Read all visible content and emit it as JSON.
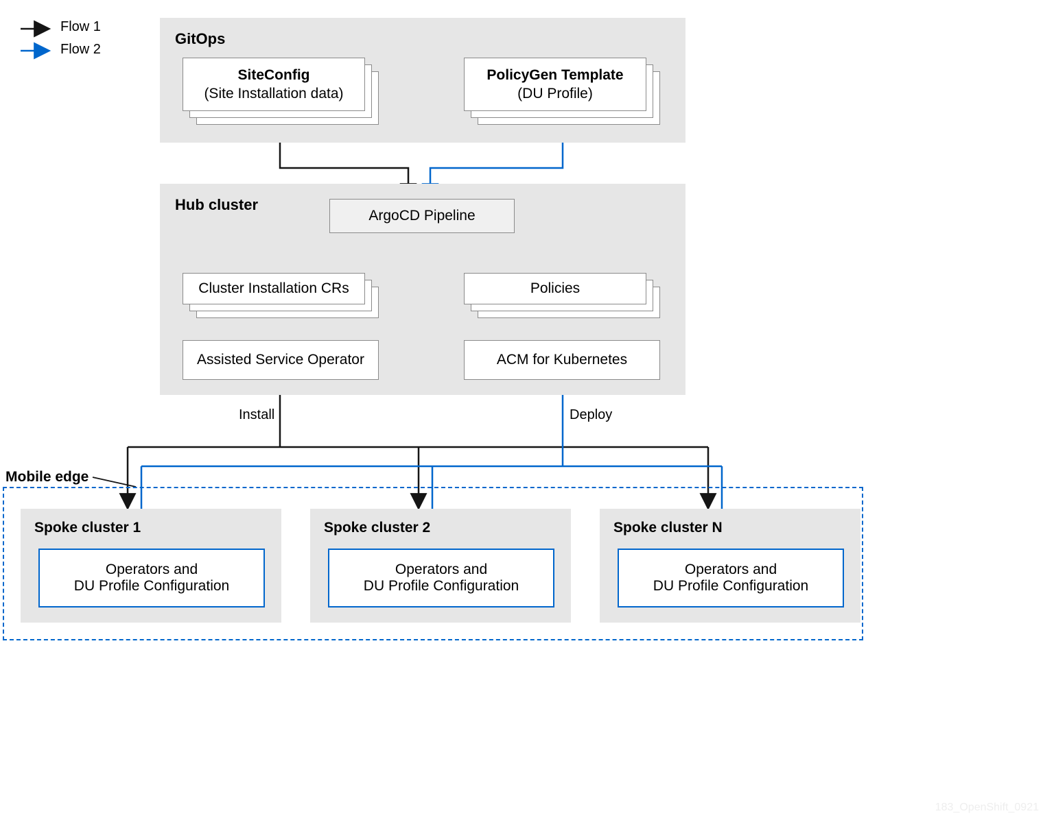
{
  "legend": {
    "flow1": "Flow 1",
    "flow2": "Flow 2"
  },
  "gitops": {
    "title": "GitOps",
    "siteconfig": {
      "title": "SiteConfig",
      "sub": "(Site Installation data)"
    },
    "policygen": {
      "title": "PolicyGen Template",
      "sub": "(DU Profile)"
    }
  },
  "hub": {
    "title": "Hub cluster",
    "argocd": "ArgoCD Pipeline",
    "clustercrs": "Cluster Installation CRs",
    "policies": "Policies",
    "assisted": "Assisted Service Operator",
    "acm": "ACM for Kubernetes"
  },
  "edge_labels": {
    "install": "Install",
    "deploy": "Deploy"
  },
  "mobile_edge": {
    "title": "Mobile edge",
    "spokes": [
      {
        "title": "Spoke cluster 1",
        "box_line1": "Operators and",
        "box_line2": "DU Profile Configuration"
      },
      {
        "title": "Spoke cluster 2",
        "box_line1": "Operators and",
        "box_line2": "DU Profile Configuration"
      },
      {
        "title": "Spoke cluster N",
        "box_line1": "Operators and",
        "box_line2": "DU Profile Configuration"
      }
    ]
  },
  "watermark": "183_OpenShift_0921"
}
